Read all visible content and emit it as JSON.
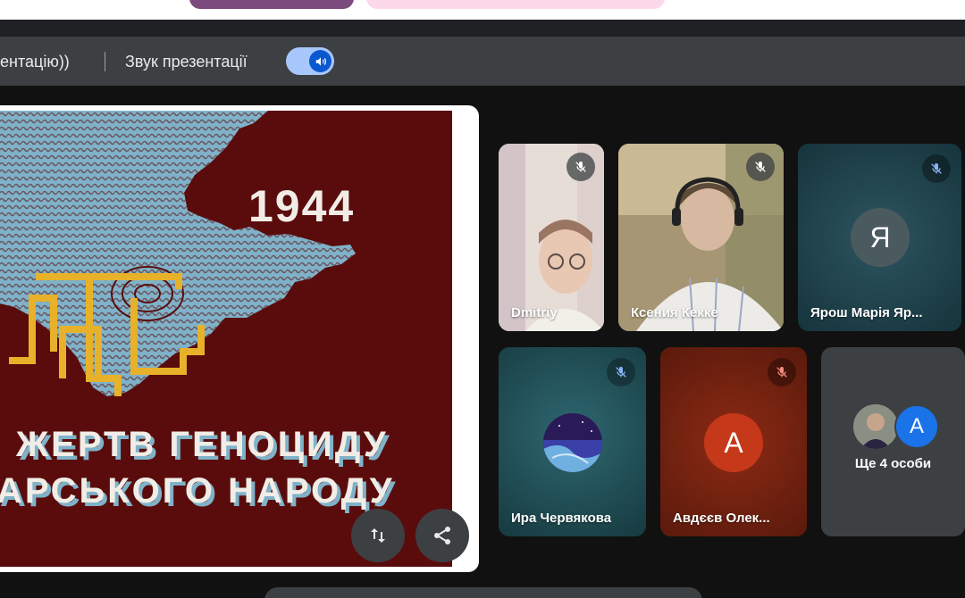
{
  "topbar": {
    "left_text": "ентацію))",
    "sound_label": "Звук презентації",
    "sound_toggle_on": true
  },
  "slide": {
    "year": "1944",
    "line1": "ЖЕРТВ ГЕНОЦИДУ",
    "line2": "АРСЬКОГО НАРОДУ",
    "colors": {
      "background": "#5a0c0c",
      "map": "#7fb2c9",
      "emblem": "#e8b12a"
    }
  },
  "participants": [
    {
      "name": "Dmitriy",
      "muted": true,
      "video": true
    },
    {
      "name": "Ксения Кекке",
      "muted": true,
      "video": true
    },
    {
      "name": "Ярош Марія Яр...",
      "muted": true,
      "avatar_letter": "Я"
    },
    {
      "name": "Ира Червякова",
      "muted": true,
      "avatar_image": true
    },
    {
      "name": "Авдєєв Олек...",
      "muted": true,
      "avatar_letter": "А"
    }
  ],
  "more": {
    "label": "Ще 4 особи",
    "avatar_letter": "А"
  },
  "colors": {
    "accent": "#a8c7fa",
    "tile_orange": "#c5381a",
    "avatar_blue": "#1a73e8"
  }
}
